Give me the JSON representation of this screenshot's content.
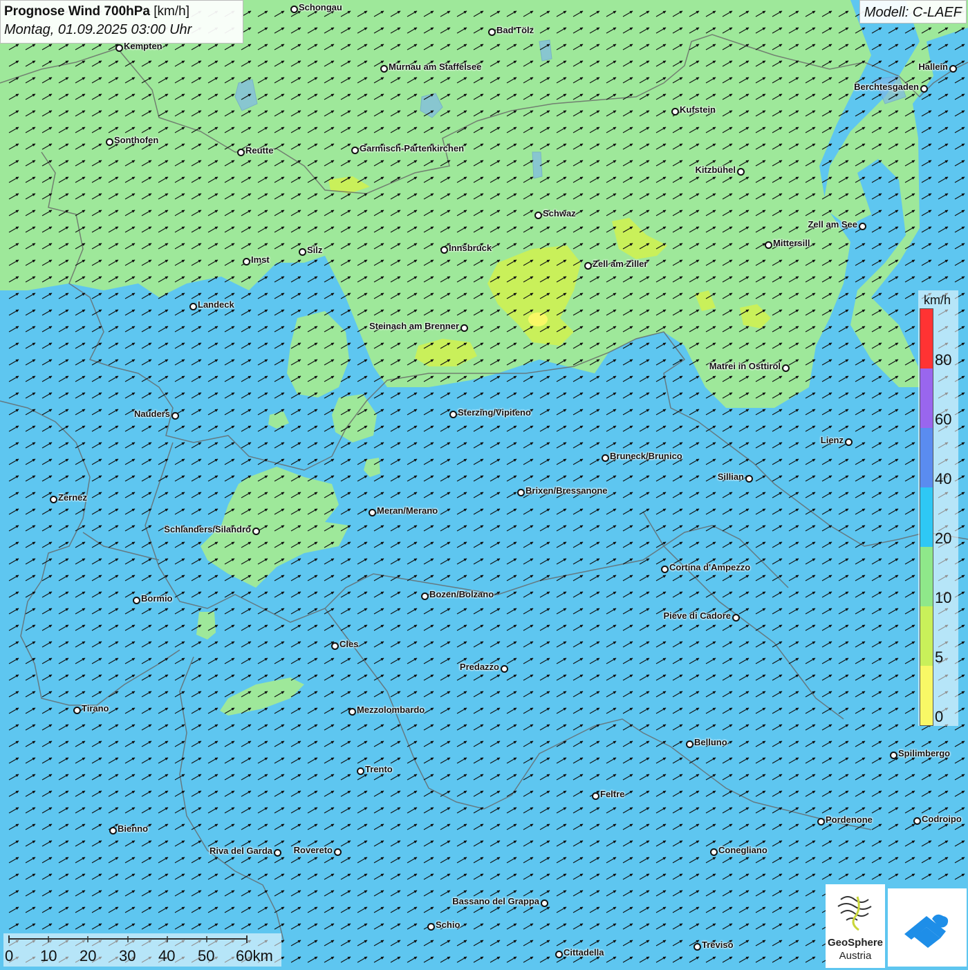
{
  "header": {
    "title_bold": "Prognose Wind 700hPa",
    "title_unit": "[km/h]",
    "datetime": "Montag, 01.09.2025 03:00 Uhr",
    "model": "Modell: C-LAEF"
  },
  "legend": {
    "unit": "km/h",
    "colors": [
      "#ff3333",
      "#9966ee",
      "#5a8cf0",
      "#2ec8f5",
      "#8fe88a",
      "#c9f05a",
      "#f8f866"
    ],
    "ticks": [
      "80",
      "60",
      "40",
      "20",
      "10",
      "5",
      "0"
    ]
  },
  "scale_bar": {
    "labels": [
      "0",
      "10",
      "20",
      "30",
      "40",
      "50",
      "60km"
    ]
  },
  "logos": {
    "geosphere_name": "GeoSphere",
    "geosphere_sub": "Austria",
    "app_icon": "app-logo-icon"
  },
  "colors": {
    "calm": "#f8f866",
    "light": "#c9f05a",
    "moderate": "#9ee89a",
    "fresh": "#5ec6f0"
  },
  "cities": [
    "Schongau",
    "Kempten",
    "Bad Tölz",
    "Murnau am Staffelsee",
    "Hallein",
    "Berchtesgaden",
    "Kufstein",
    "Sonthofen",
    "Reutte",
    "Garmisch-Partenkirchen",
    "Kitzbühel",
    "Schwaz",
    "Zell am See",
    "Mittersill",
    "Imst",
    "Silz",
    "Innsbruck",
    "Zell am Ziller",
    "Landeck",
    "Steinach am Brenner",
    "Matrei in Osttirol",
    "Nauders",
    "Sterzing/Vipiteno",
    "Lienz",
    "Bruneck/Brunico",
    "Sillian",
    "Zernez",
    "Brixen/Bressanone",
    "Meran/Merano",
    "Schlanders/Silandro",
    "Cortina d'Ampezzo",
    "Bormio",
    "Bozen/Bolzano",
    "Pieve di Cadore",
    "Cles",
    "Predazzo",
    "Tirano",
    "Mezzolombardo",
    "Belluno",
    "Spilimbergo",
    "Trento",
    "Feltre",
    "Pordenone",
    "Codroipo",
    "Bienno",
    "Riva del Garda",
    "Rovereto",
    "Conegliano",
    "Bassano del Grappa",
    "Schio",
    "Treviso",
    "Cittadella"
  ]
}
